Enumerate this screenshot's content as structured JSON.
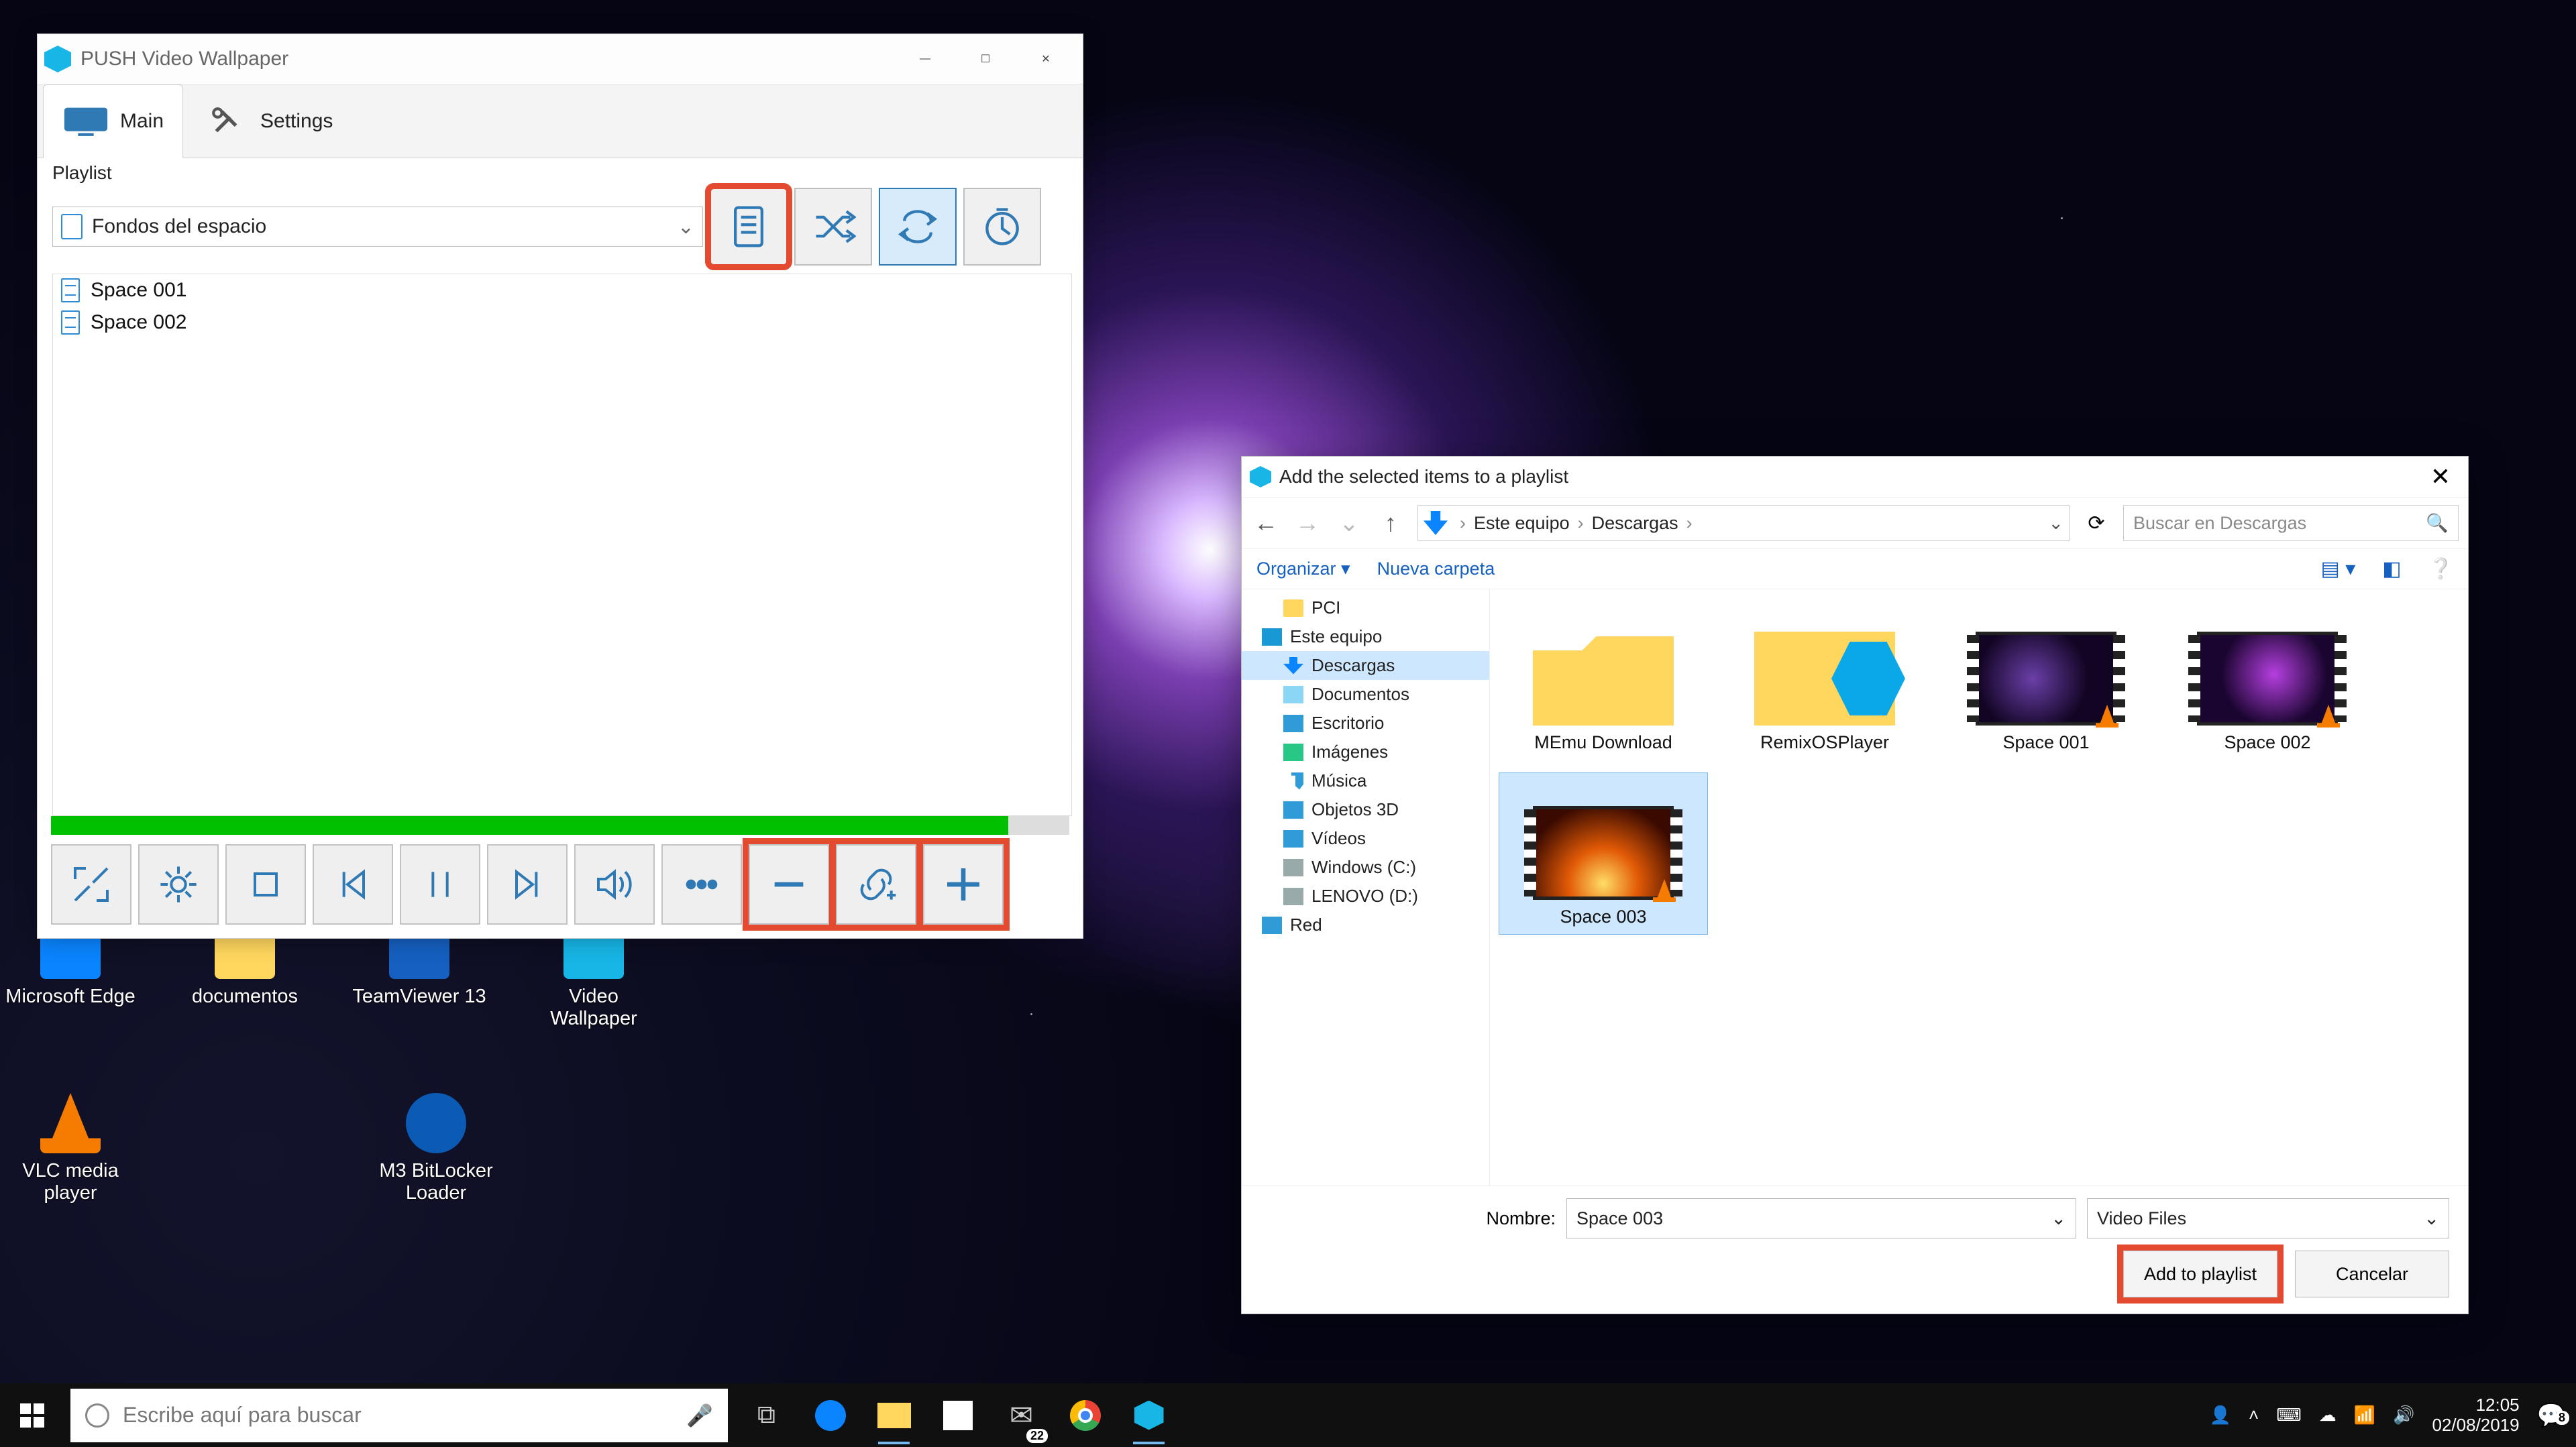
{
  "push": {
    "title": "PUSH Video Wallpaper",
    "tabs": {
      "main": "Main",
      "settings": "Settings"
    },
    "playlist_label": "Playlist",
    "playlist_selected": "Fondos del espacio",
    "tracks": [
      "Space 001",
      "Space 002"
    ]
  },
  "dialog": {
    "title": "Add the selected items to a playlist",
    "breadcrumb": [
      "Este equipo",
      "Descargas"
    ],
    "search_placeholder": "Buscar en Descargas",
    "toolbar": {
      "organize": "Organizar",
      "new_folder": "Nueva carpeta"
    },
    "tree": [
      {
        "label": "PCI",
        "icon": "folder",
        "indent": 1
      },
      {
        "label": "Este equipo",
        "icon": "pc",
        "indent": 0
      },
      {
        "label": "Descargas",
        "icon": "dl",
        "indent": 1,
        "selected": true
      },
      {
        "label": "Documentos",
        "icon": "doc",
        "indent": 1
      },
      {
        "label": "Escritorio",
        "icon": "desk",
        "indent": 1
      },
      {
        "label": "Imágenes",
        "icon": "img",
        "indent": 1
      },
      {
        "label": "Música",
        "icon": "mus",
        "indent": 1
      },
      {
        "label": "Objetos 3D",
        "icon": "obj",
        "indent": 1
      },
      {
        "label": "Vídeos",
        "icon": "vid",
        "indent": 1
      },
      {
        "label": "Windows (C:)",
        "icon": "drv",
        "indent": 1
      },
      {
        "label": "LENOVO (D:)",
        "icon": "drv",
        "indent": 1
      },
      {
        "label": "Red",
        "icon": "net",
        "indent": 0
      }
    ],
    "files": [
      {
        "label": "MEmu Download",
        "kind": "folder"
      },
      {
        "label": "RemixOSPlayer",
        "kind": "remix"
      },
      {
        "label": "Space 001",
        "kind": "film1"
      },
      {
        "label": "Space 002",
        "kind": "film2"
      },
      {
        "label": "Space 003",
        "kind": "film3",
        "selected": true
      }
    ],
    "name_label": "Nombre:",
    "name_value": "Space 003",
    "type_value": "Video Files",
    "ok": "Add to playlist",
    "cancel": "Cancelar"
  },
  "desktop_icons": [
    {
      "label": "Microsoft Edge"
    },
    {
      "label": "documentos"
    },
    {
      "label": "TeamViewer 13"
    },
    {
      "label": "Video Wallpaper"
    },
    {
      "label": "VLC media player"
    },
    {
      "label": "M3 BitLocker Loader"
    }
  ],
  "taskbar": {
    "search_placeholder": "Escribe aquí para buscar",
    "mail_badge": "22",
    "time": "12:05",
    "date": "02/08/2019",
    "notif_badge": "8"
  }
}
